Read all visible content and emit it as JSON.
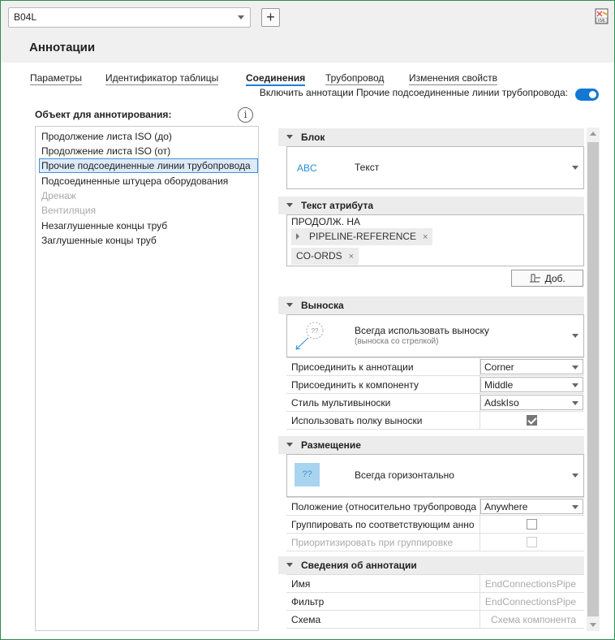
{
  "toolbar": {
    "style_value": "B04L",
    "add_label": "+"
  },
  "page": {
    "title": "Аннотации"
  },
  "tabs": [
    {
      "label": "Параметры"
    },
    {
      "label": "Идентификатор таблицы"
    },
    {
      "label": "Соединения"
    },
    {
      "label": "Трубопровод"
    },
    {
      "label": "Изменения свойств"
    }
  ],
  "enable_annotations": {
    "label": "Включить аннотации Прочие подсоединенные линии трубопровода:",
    "on": true
  },
  "object_list": {
    "heading": "Объект для аннотирования:",
    "items": [
      {
        "label": "Продолжение листа ISO (до)"
      },
      {
        "label": "Продолжение листа ISO (от)"
      },
      {
        "label": "Прочие подсоединенные линии трубопровода"
      },
      {
        "label": "Подсоединенные штуцера оборудования"
      },
      {
        "label": "Дренаж"
      },
      {
        "label": "Вентиляция"
      },
      {
        "label": "Незаглушенные концы труб"
      },
      {
        "label": "Заглушенные концы труб"
      }
    ]
  },
  "block": {
    "header": "Блок",
    "icon_text": "ABC",
    "value": "Текст"
  },
  "attribute_text": {
    "header": "Текст атрибута",
    "prefix": "ПРОДОЛЖ. НА",
    "chips": [
      "PIPELINE-REFERENCE",
      "CO-ORDS"
    ],
    "chip_remove": "×",
    "add_button": "Доб."
  },
  "leader": {
    "header": "Выноска",
    "icon_text": "??",
    "value": "Всегда использовать выноску",
    "sub": "(выноска со стрелкой)",
    "props": [
      {
        "label": "Присоединить к аннотации",
        "value": "Corner"
      },
      {
        "label": "Присоединить к компоненту",
        "value": "Middle"
      },
      {
        "label": "Стиль мультивыноски",
        "value": "AdskIso"
      },
      {
        "label": "Использовать полку выноски",
        "checked": true
      }
    ]
  },
  "placement": {
    "header": "Размещение",
    "icon_text": "??",
    "value": "Всегда горизонтально",
    "props": [
      {
        "label": "Положение (относительно трубопровода",
        "value": "Anywhere"
      },
      {
        "label": "Группировать по соответствующим анно",
        "checked": false
      },
      {
        "label": "Приоритизировать при группировке",
        "checked": false,
        "disabled": true
      }
    ]
  },
  "annotation_info": {
    "header": "Сведения об аннотации",
    "props": [
      {
        "label": "Имя",
        "value": "EndConnectionsPipe"
      },
      {
        "label": "Фильтр",
        "value": "EndConnectionsPipe"
      },
      {
        "label": "Схема",
        "value": "Схема компонента"
      }
    ]
  },
  "colors": {
    "accent": "#1278d4",
    "selection_bg": "#ddebf9",
    "selection_border": "#3f8fd8",
    "frame": "#2a8f4a"
  }
}
